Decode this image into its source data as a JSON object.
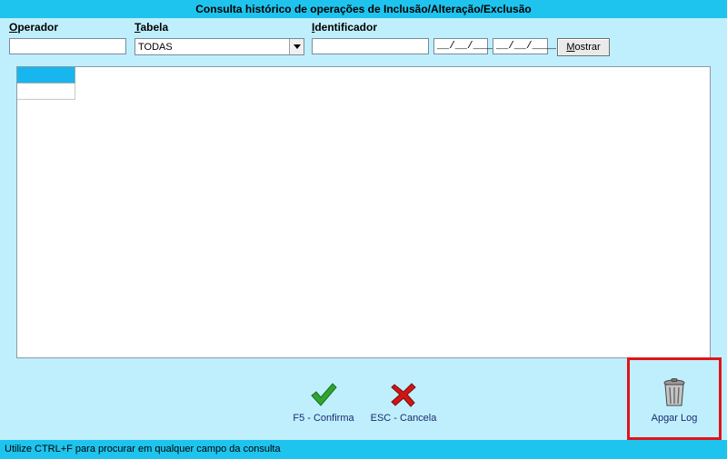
{
  "window": {
    "title": "Consulta histórico de operações de Inclusão/Alteração/Exclusão"
  },
  "filters": {
    "operador": {
      "label_first": "O",
      "label_rest": "perador",
      "value": ""
    },
    "tabela": {
      "label_first": "T",
      "label_rest": "abela",
      "selected": "TODAS"
    },
    "identificador": {
      "label_first": "I",
      "label_rest": "dentificador",
      "value": ""
    },
    "date_from": "__/__/____",
    "date_to": "__/__/____",
    "mostrar": {
      "label_first": "M",
      "label_rest": "ostrar"
    }
  },
  "actions": {
    "confirm": {
      "label": "F5 - Confirma",
      "icon": "checkmark-icon",
      "color": "#2fa52f"
    },
    "cancel": {
      "label": "ESC - Cancela",
      "icon": "x-cancel-icon",
      "color": "#d01515"
    },
    "clear_log": {
      "label": "Apgar Log",
      "icon": "trash-can-icon"
    }
  },
  "status": {
    "text": "Utilize CTRL+F  para procurar em qualquer campo da consulta"
  },
  "colors": {
    "background": "#bfeffd",
    "bars": "#1ec4ee",
    "header_cell": "#17b6ee",
    "highlight": "#e0131b"
  }
}
